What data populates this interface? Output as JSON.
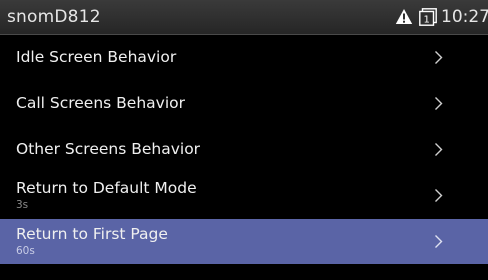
{
  "status": {
    "title": "snomD812",
    "line_number": "1",
    "time": "10:27"
  },
  "colors": {
    "selected_row": "#5a64a6",
    "status_bar": "#303030",
    "background": "#000000"
  },
  "menu": {
    "items": [
      {
        "label": "Idle Screen Behavior",
        "sub": ""
      },
      {
        "label": "Call Screens Behavior",
        "sub": ""
      },
      {
        "label": "Other Screens Behavior",
        "sub": ""
      },
      {
        "label": "Return to Default Mode",
        "sub": "3s"
      },
      {
        "label": "Return to First Page",
        "sub": "60s",
        "selected": true
      }
    ]
  }
}
